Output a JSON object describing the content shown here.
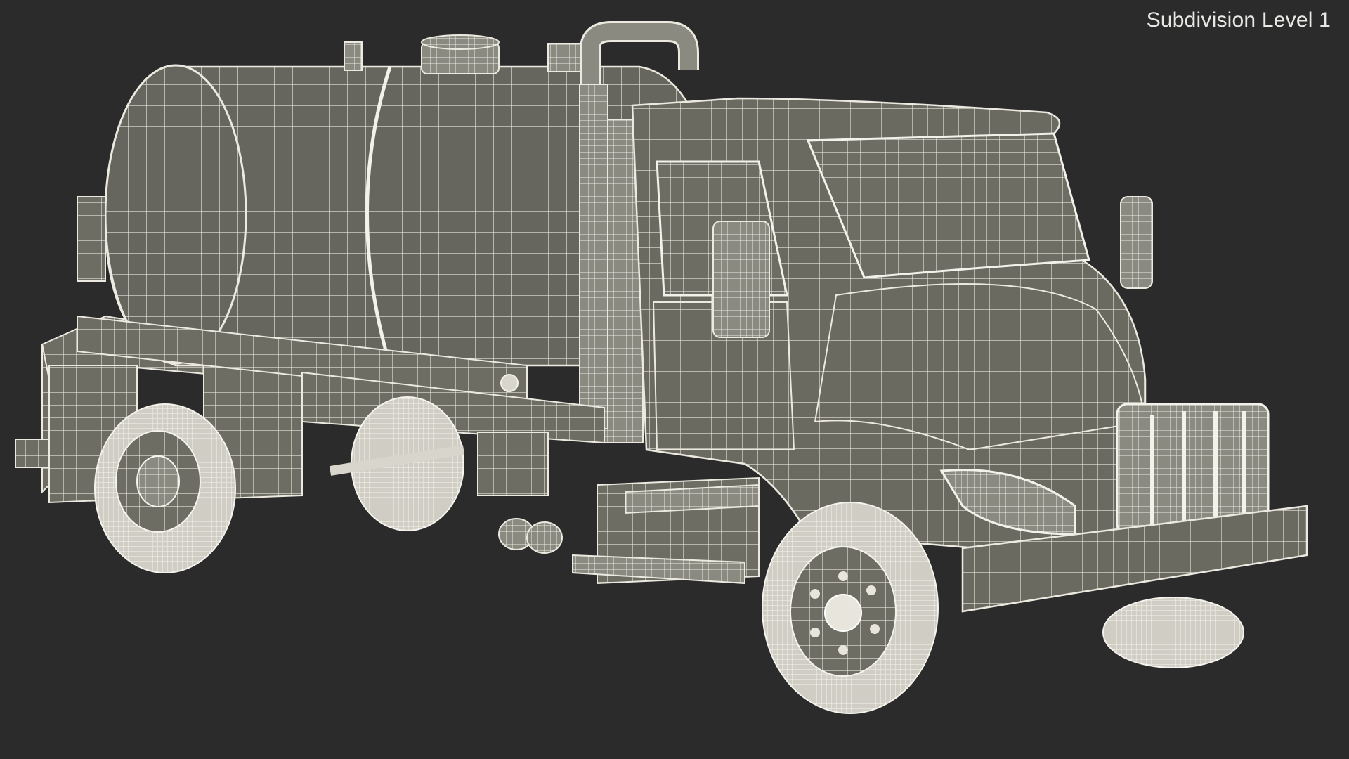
{
  "viewport": {
    "label": "Subdivision Level 1",
    "background_color": "#2b2b2b",
    "mesh_fill_color": "#6b6b62",
    "wire_color": "#e8e6dc"
  }
}
